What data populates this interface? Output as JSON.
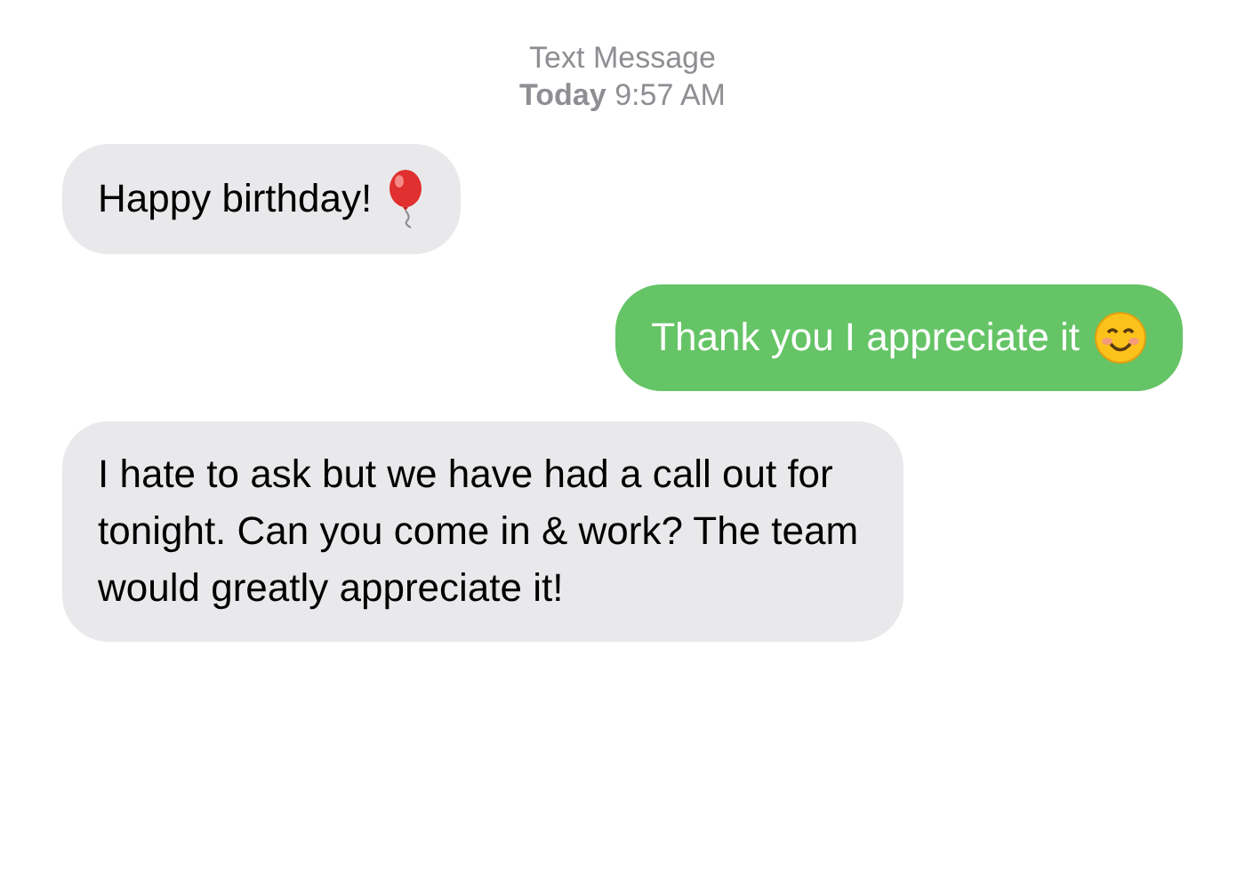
{
  "header": {
    "title": "Text Message",
    "time": "**Today** 9:57 AM"
  },
  "messages": [
    {
      "kind": "received",
      "text": "Happy birthday!"
    },
    {
      "kind": "sent",
      "text": "Thank you I appreciate it"
    },
    {
      "kind": "received",
      "text": "I hate to ask but we have had a call out for tonight. Can you come in & work? The team would greatly appreciate it!"
    }
  ]
}
